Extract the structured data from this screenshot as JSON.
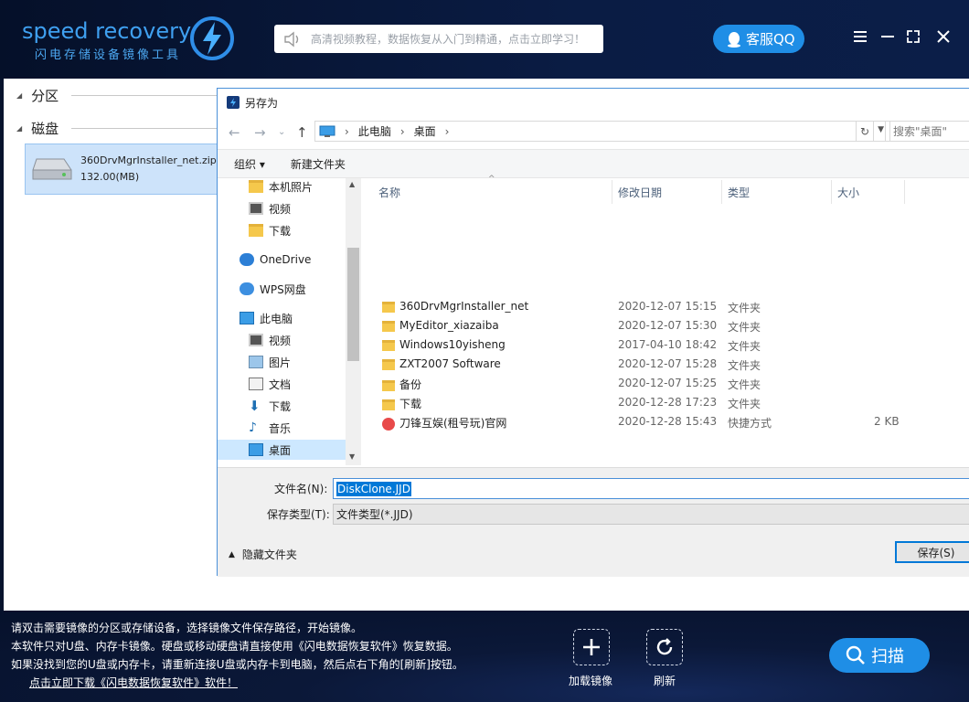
{
  "app": {
    "logo_text": "speed recovery",
    "logo_sub": "闪电存储设备镜像工具",
    "notice": "高清视频教程，数据恢复从入门到精通，点击立即学习！",
    "qq_label": "客服QQ"
  },
  "left_panel": {
    "section_partition": "分区",
    "section_disk": "磁盘",
    "disk_name": "360DrvMgrInstaller_net.zip",
    "disk_size": "132.00(MB)"
  },
  "dialog": {
    "title": "另存为",
    "breadcrumb": [
      "此电脑",
      "桌面"
    ],
    "search_placeholder": "搜索\"桌面\"",
    "toolbar": {
      "organize": "组织 ▾",
      "new_folder": "新建文件夹"
    },
    "nav_items": [
      {
        "label": "本机照片",
        "icon": "folder-icon"
      },
      {
        "label": "视频",
        "icon": "video-icon"
      },
      {
        "label": "下载",
        "icon": "folder-icon"
      },
      {
        "label": "OneDrive",
        "icon": "cloud-icon"
      },
      {
        "label": "WPS网盘",
        "icon": "cloud-icon"
      },
      {
        "label": "此电脑",
        "icon": "computer-icon"
      },
      {
        "label": "视频",
        "icon": "video-icon"
      },
      {
        "label": "图片",
        "icon": "picture-icon"
      },
      {
        "label": "文档",
        "icon": "document-icon"
      },
      {
        "label": "下载",
        "icon": "download-icon"
      },
      {
        "label": "音乐",
        "icon": "music-icon"
      },
      {
        "label": "桌面",
        "icon": "desktop-icon"
      }
    ],
    "columns": [
      "名称",
      "修改日期",
      "类型",
      "大小"
    ],
    "files": [
      {
        "name": "360DrvMgrInstaller_net",
        "date": "2020-12-07 15:15",
        "type": "文件夹",
        "size": ""
      },
      {
        "name": "MyEditor_xiazaiba",
        "date": "2020-12-07 15:30",
        "type": "文件夹",
        "size": ""
      },
      {
        "name": "Windows10yisheng",
        "date": "2017-04-10 18:42",
        "type": "文件夹",
        "size": ""
      },
      {
        "name": "ZXT2007 Software",
        "date": "2020-12-07 15:28",
        "type": "文件夹",
        "size": ""
      },
      {
        "name": "备份",
        "date": "2020-12-07 15:25",
        "type": "文件夹",
        "size": ""
      },
      {
        "name": "下载",
        "date": "2020-12-28 17:23",
        "type": "文件夹",
        "size": ""
      },
      {
        "name": "刀锋互娱(租号玩)官网",
        "date": "2020-12-28 15:43",
        "type": "快捷方式",
        "size": "2 KB"
      }
    ],
    "filename_label": "文件名(N):",
    "filename_value": "DiskClone.JJD",
    "filetype_label": "保存类型(T):",
    "filetype_value": "文件类型(*.JJD)",
    "hide_folders": "隐藏文件夹",
    "save_label": "保存(S)"
  },
  "footer": {
    "line1": "请双击需要镜像的分区或存储设备，选择镜像文件保存路径，开始镜像。",
    "line2": "本软件只对U盘、内存卡镜像。硬盘或移动硬盘请直接使用《闪电数据恢复软件》恢复数据。",
    "line3": "如果没找到您的U盘或内存卡，请重新连接U盘或内存卡到电脑，然后点右下角的[刷新]按钮。",
    "link": "点击立即下载《闪电数据恢复软件》软件！",
    "load_label": "加载镜像",
    "refresh_label": "刷新",
    "scan_label": "扫描"
  }
}
